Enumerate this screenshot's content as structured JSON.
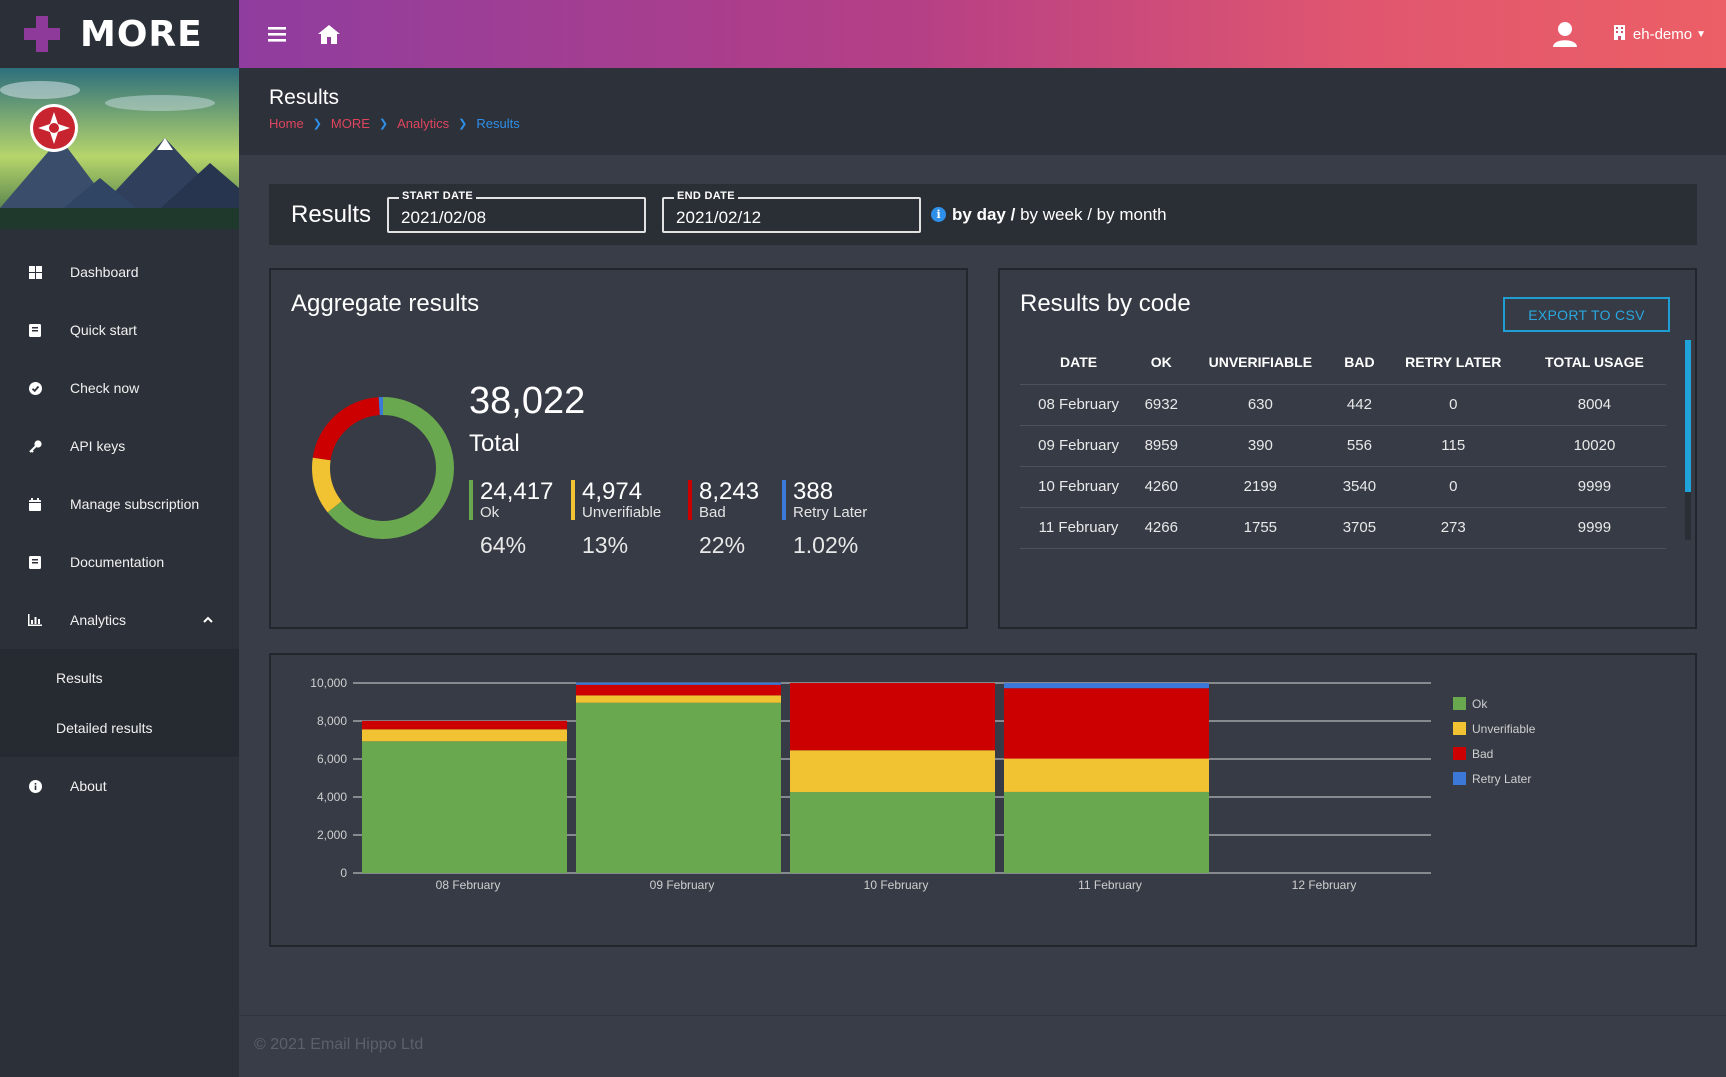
{
  "brand": {
    "name": "MORE"
  },
  "sidebar": {
    "items": [
      {
        "label": "Dashboard",
        "icon": "dashboard-icon"
      },
      {
        "label": "Quick start",
        "icon": "book-icon"
      },
      {
        "label": "Check now",
        "icon": "check-circle-icon"
      },
      {
        "label": "API keys",
        "icon": "key-icon"
      },
      {
        "label": "Manage subscription",
        "icon": "calendar-icon"
      },
      {
        "label": "Documentation",
        "icon": "book-icon"
      },
      {
        "label": "Analytics",
        "icon": "bar-chart-icon",
        "expanded": true
      },
      {
        "label": "About",
        "icon": "info-icon"
      }
    ],
    "analytics_sub": [
      {
        "label": "Results"
      },
      {
        "label": "Detailed results"
      }
    ]
  },
  "topbar": {
    "account": "eh-demo",
    "icons": [
      "hamburger-icon",
      "home-icon",
      "user-icon",
      "building-icon"
    ]
  },
  "header": {
    "title": "Results",
    "breadcrumbs": [
      "Home",
      "MORE",
      "Analytics",
      "Results"
    ]
  },
  "filters": {
    "title": "Results",
    "start_label": "START DATE",
    "start_value": "2021/02/08",
    "end_label": "END DATE",
    "end_value": "2021/02/12",
    "by_day": "by day",
    "sep1": "/",
    "by_week": "by week",
    "sep2": "/",
    "by_month": "by month"
  },
  "aggregate": {
    "title": "Aggregate results",
    "total": "38,022",
    "total_label": "Total",
    "stats": [
      {
        "value": "24,417",
        "label": "Ok",
        "pct": "64%",
        "color": "#6aa84f"
      },
      {
        "value": "4,974",
        "label": "Unverifiable",
        "pct": "13%",
        "color": "#f1c232"
      },
      {
        "value": "8,243",
        "label": "Bad",
        "pct": "22%",
        "color": "#cc0000"
      },
      {
        "value": "388",
        "label": "Retry Later",
        "pct": "1.02%",
        "color": "#3c78d8"
      }
    ]
  },
  "bycode": {
    "title": "Results by code",
    "export": "EXPORT TO CSV",
    "columns": [
      "DATE",
      "OK",
      "UNVERIFIABLE",
      "BAD",
      "RETRY LATER",
      "TOTAL USAGE"
    ],
    "rows": [
      [
        "08 February",
        "6932",
        "630",
        "442",
        "0",
        "8004"
      ],
      [
        "09 February",
        "8959",
        "390",
        "556",
        "115",
        "10020"
      ],
      [
        "10 February",
        "4260",
        "2199",
        "3540",
        "0",
        "9999"
      ],
      [
        "11 February",
        "4266",
        "1755",
        "3705",
        "273",
        "9999"
      ]
    ]
  },
  "chart_data": [
    {
      "type": "pie",
      "variant": "donut",
      "labels": [
        "Ok",
        "Unverifiable",
        "Bad",
        "Retry Later"
      ],
      "values": [
        24417,
        4974,
        8243,
        388
      ],
      "colors": [
        "#6aa84f",
        "#f1c232",
        "#cc0000",
        "#3c78d8"
      ]
    },
    {
      "type": "bar",
      "stacked": true,
      "categories": [
        "08 February",
        "09 February",
        "10 February",
        "11 February",
        "12 February"
      ],
      "series": [
        {
          "name": "Ok",
          "values": [
            6932,
            8959,
            4260,
            4266,
            0
          ],
          "color": "#6aa84f"
        },
        {
          "name": "Unverifiable",
          "values": [
            630,
            390,
            2199,
            1755,
            0
          ],
          "color": "#f1c232"
        },
        {
          "name": "Bad",
          "values": [
            442,
            556,
            3540,
            3705,
            0
          ],
          "color": "#cc0000"
        },
        {
          "name": "Retry Later",
          "values": [
            0,
            115,
            0,
            273,
            0
          ],
          "color": "#3c78d8"
        }
      ],
      "ylim": [
        0,
        10000
      ],
      "yticks": [
        "0",
        "2,000",
        "4,000",
        "6,000",
        "8,000",
        "10,000"
      ],
      "grid": true,
      "legend": "right"
    }
  ],
  "footer": {
    "text": "© 2021 Email Hippo Ltd"
  }
}
